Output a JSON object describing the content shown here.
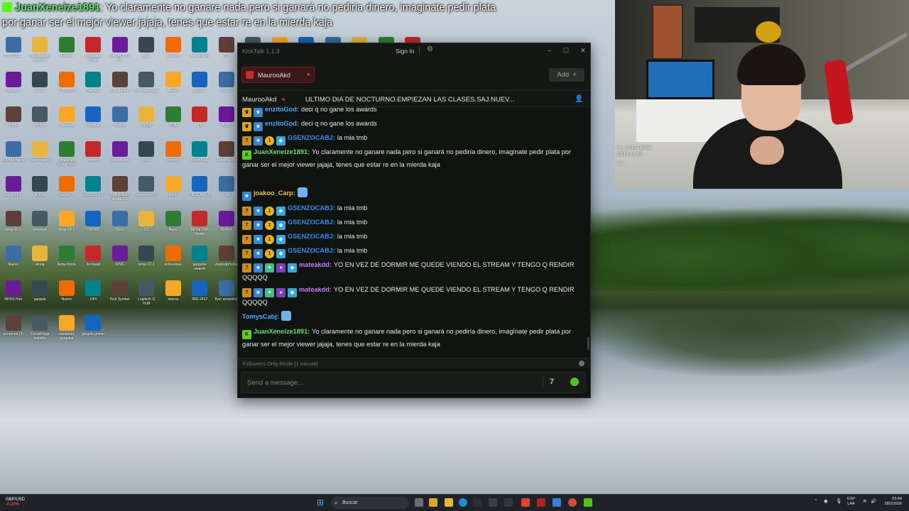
{
  "overlay": {
    "username": "JuanXeneize1891",
    "message": ": Yo claramente no ganare nada pero si ganará no pediria dinero, imaginate pedir plata por ganar ser el mejor viewer jajaja, tenes que estar re en la mierda kaja"
  },
  "webcam_chat": {
    "line1": "rito: USER BANA",
    "line2": "VOTA A LAS",
    "line3": "ser:"
  },
  "kicktalk": {
    "app_title": "KickTalk 1.1.3",
    "sign_in": "Sign In",
    "tab_label": "MaurooAkd",
    "tab_close": "×",
    "add_label": "Add",
    "add_icon": "+",
    "channel_name": "MaurooAkd",
    "stream_title": "ULTIMO DIA DE NOCTURNO.EMPIEZAN LAS CLASES.SAJ.NUEV...",
    "followers_mode": "Followers Only Mode [1 minute]",
    "input_placeholder": "Send a message...",
    "emote_button": "7",
    "minimize": "–",
    "maximize": "☐",
    "close": "✕"
  },
  "messages": [
    {
      "badges": [
        "crown",
        "blue"
      ],
      "user": "enzitoGod",
      "user_color": "#4aa8ff",
      "text": "deci q no gane los awards"
    },
    {
      "badges": [
        "crown",
        "blue"
      ],
      "user": "enzitoGod",
      "user_color": "#4aa8ff",
      "text": "deci q no gane los awards"
    },
    {
      "badges": [
        "sub",
        "blue",
        "gold",
        "diam"
      ],
      "user": "GSENZOCABJ",
      "user_color": "#2d8cf0",
      "text": "la mia tmb"
    },
    {
      "badges": [
        "lime"
      ],
      "user": "JuanXeneize1891",
      "user_color": "#5fe26a",
      "text": "Yo claramente no ganare nada pero si ganará no pediría dinero, imagínate pedir plata por ganar ser el mejor viewer jajaja, tenes que estar re en la mierda kaja"
    },
    {
      "badges": [
        "blue"
      ],
      "user": "joakoo_Carp",
      "user_color": "#e6c230",
      "text": "",
      "emote": true
    },
    {
      "badges": [
        "sub",
        "blue",
        "gold",
        "diam"
      ],
      "user": "GSENZOCABJ",
      "user_color": "#2d8cf0",
      "text": "la mia tmb"
    },
    {
      "badges": [
        "sub",
        "blue",
        "gold",
        "diam"
      ],
      "user": "GSENZOCABJ",
      "user_color": "#2d8cf0",
      "text": "la mia tmb"
    },
    {
      "badges": [
        "sub",
        "blue",
        "gold",
        "diam"
      ],
      "user": "GSENZOCABJ",
      "user_color": "#2d8cf0",
      "text": "la mia tmb"
    },
    {
      "badges": [
        "sub",
        "blue",
        "gold",
        "diam"
      ],
      "user": "GSENZOCABJ",
      "user_color": "#2d8cf0",
      "text": "la mia tmb"
    },
    {
      "badges": [
        "sub",
        "blue",
        "green",
        "purple",
        "diam"
      ],
      "user": "mateakdd",
      "user_color": "#c67aff",
      "text": "YO EN VEZ DE DORMIR ME QUEDE VIENDO EL STREAM Y TENGO Q RENDIR QQQQQ"
    },
    {
      "badges": [
        "sub",
        "blue",
        "green",
        "purple",
        "diam"
      ],
      "user": "mateakdd",
      "user_color": "#c67aff",
      "text": "YO EN VEZ DE DORMIR ME QUEDE VIENDO EL STREAM Y TENGO Q RENDIR QQQQQ"
    },
    {
      "badges": [],
      "user": "TomysCabj",
      "user_color": "#4aa8ff",
      "text": "",
      "emote": true
    },
    {
      "badges": [
        "lime"
      ],
      "user": "JuanXeneize1891",
      "user_color": "#5fe26a",
      "text": "Yo claramente no ganare nada pero si ganará no pediría dinero, imagínate pedir plata por ganar ser el mejor viewer jajaja, tenes que estar re en la mierda kaja"
    }
  ],
  "desktop_icons": [
    "ITTF0123...",
    "Pro Evolution Soccer 6",
    "Fortnite",
    "WhatsApp Image",
    "EA SPORTS FC",
    "gg d",
    "Valorant",
    "transmision",
    "TOP",
    "DaVinci Resolve",
    "Pack Emotes",
    "Spotify",
    "Epic Games Launcher",
    "GIF",
    "gargolas",
    "R",
    "blackbox",
    "gargola",
    "IF7021000",
    "Capturas",
    "LOL tracker",
    "Microsoft Edge",
    "Nuevo",
    "gargola",
    "mobile",
    "Adobe Premiere",
    "ZKM",
    "Pixelmon",
    "Modpack",
    "Carpeta",
    "arquimed",
    "Frase",
    "fondo",
    "codigo",
    "Carpetas",
    "clasificar",
    "bordes",
    "TikTok",
    "CTA",
    "TA",
    "HUSS",
    "flayer",
    "Nuevo",
    "Gcs",
    "stranger",
    "grizas fondo",
    "thumbnail",
    "Extension",
    "MSI Afterburner",
    "flayer maceta",
    "WhatsApp Image 2026",
    "momo",
    "pantallazos",
    "once",
    "sg mira",
    "flayer AME",
    "black-backs",
    "Pack de Recursos",
    "gargola 2",
    "gargolas awards",
    "r7cdb",
    "toro_upsca",
    "EL MEJOR PHONK",
    "Nuevo fondo",
    "temp-14-1",
    "kickfak",
    "pelota 1",
    "GARGOLA 3",
    "GARGOLAS AWARDS",
    "unnamed (1)",
    "tiktok",
    "DESCARGA",
    "snkk",
    "temp-16-1",
    "DSHMC",
    "Roblox Studio",
    "GARGOLA 4",
    "blogers",
    "unnamed",
    "EA",
    "temp-16-1",
    "message",
    "temp-18-1",
    "DSHMC",
    "Rizzl",
    "GS",
    "flayer",
    "TikTok LIVE Studio",
    "Dp9RA",
    "Capture 2",
    "solar mejico",
    "Cruzada",
    "Counter-Strike 2",
    "temp-17-1",
    "gifF",
    "papel ticket",
    "Nuevo",
    "winrar",
    "llama fondo",
    "brickwall",
    "KING",
    "temp-17-1",
    "entrevistas",
    "gargolas awards",
    "depositphotos",
    "flayer modo camera",
    "milestone",
    "rans-gzo",
    "OBS Studio",
    "ABT1",
    "Asus DriverHub",
    "CS2",
    "NHUS Hub",
    "gargola",
    "Nuevo",
    "OIH",
    "Kick Symbol",
    "Logitech G HUB",
    "micros",
    "IMG 2417",
    "flyer acoustica",
    "stockphoto",
    "bcb2428",
    "BlueStacks",
    "al the stars",
    "Adobe Premiere",
    "EpicInstaller",
    "Steam",
    "unnamed (3)",
    "CurseForge Installer",
    "camisetas gargolas",
    "gargola primer"
  ],
  "taskbar": {
    "ticker_label": "GBP/USD",
    "ticker_change": "-0,20%",
    "search_label": "Buscar",
    "lang_line1": "ESP",
    "lang_line2": "LAA",
    "time": "03:44",
    "date": "28/2/2026"
  }
}
